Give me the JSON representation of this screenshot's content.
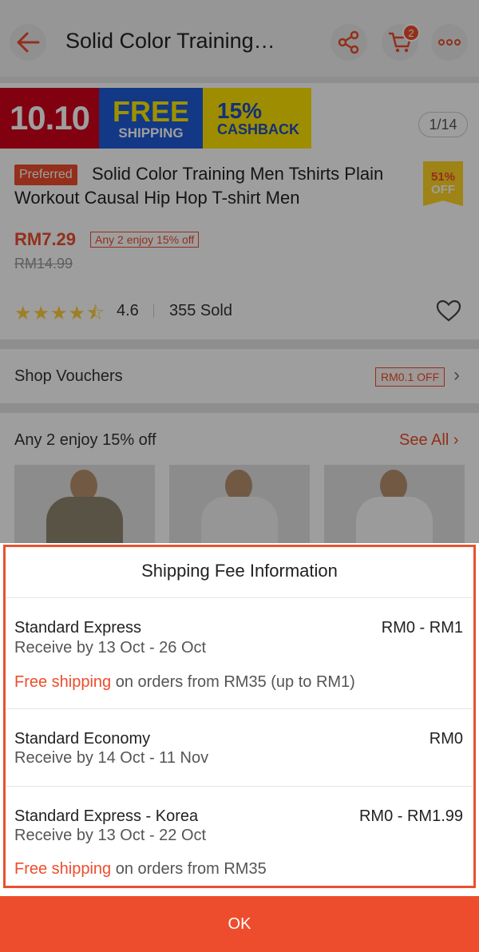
{
  "header": {
    "title": "Solid Color Training…",
    "cart_count": "2",
    "icons": [
      "back-arrow-icon",
      "share-icon",
      "cart-icon",
      "more-icon"
    ]
  },
  "banner": {
    "date": "10.10",
    "free_top": "FREE",
    "free_bottom": "SHIPPING",
    "cashback_top": "15%",
    "cashback_bottom": "CASHBACK"
  },
  "image_counter": "1/14",
  "product": {
    "badge": "Preferred",
    "title": "Solid Color Training Men Tshirts Plain Workout Causal Hip Hop T-shirt Men",
    "discount_top": "51%",
    "discount_bottom": "OFF",
    "price": "RM7.29",
    "promo": "Any 2 enjoy 15% off",
    "original_price": "RM14.99",
    "stars": "★★★★⯪",
    "rating": "4.6",
    "sold": "355 Sold"
  },
  "vouchers": {
    "label": "Shop Vouchers",
    "tag": "RM0.1 OFF",
    "chevron": "›"
  },
  "bundle": {
    "label": "Any 2 enjoy 15% off",
    "see_all": "See All ›"
  },
  "shipping_sheet": {
    "title": "Shipping Fee Information",
    "options": [
      {
        "name": "Standard Express",
        "receive": "Receive by 13 Oct - 26 Oct",
        "fee": "RM0 - RM1",
        "note_highlight": "Free shipping",
        "note_rest": " on orders from RM35 (up to RM1)"
      },
      {
        "name": "Standard Economy",
        "receive": "Receive by 14 Oct - 11 Nov",
        "fee": "RM0"
      },
      {
        "name": "Standard Express - Korea",
        "receive": "Receive by 13 Oct - 22 Oct",
        "fee": "RM0 - RM1.99",
        "note_highlight": "Free shipping",
        "note_rest": " on orders from RM35"
      }
    ],
    "ok_label": "OK"
  },
  "colors": {
    "accent": "#ee4d2d",
    "outline": "#e8512f"
  }
}
